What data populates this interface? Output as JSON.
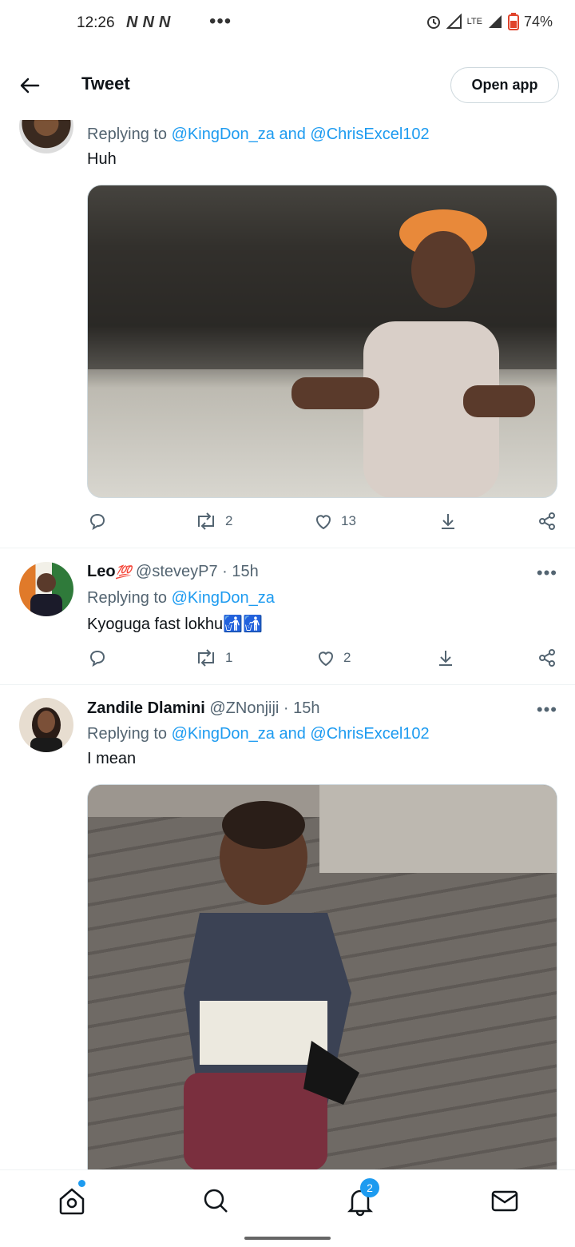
{
  "status": {
    "time": "12:26",
    "battery": "74%",
    "network": "LTE"
  },
  "header": {
    "title": "Tweet",
    "open_app": "Open app"
  },
  "tweet1": {
    "reply_prefix": "Replying to",
    "mention1": "@KingDon_za",
    "and": "and",
    "mention2": "@ChrisExcel102",
    "text": "Huh",
    "retweets": "2",
    "likes": "13"
  },
  "tweet2": {
    "name": "Leo",
    "emoji": "💯",
    "handle": "@steveyP7 · 15h",
    "reply_prefix": "Replying to",
    "mention1": "@KingDon_za",
    "text": "Kyoguga fast lokhu",
    "text_emoji": "🚮🚮",
    "retweets": "1",
    "likes": "2"
  },
  "tweet3": {
    "name": "Zandile Dlamini",
    "handle": "@ZNonjiji · 15h",
    "reply_prefix": "Replying to",
    "mention1": "@KingDon_za",
    "and": "and",
    "mention2": "@ChrisExcel102",
    "text": "I mean"
  },
  "nav": {
    "notifications_badge": "2"
  },
  "colors": {
    "accent": "#1d9bf0",
    "text": "#0f1419",
    "secondary": "#536471"
  }
}
